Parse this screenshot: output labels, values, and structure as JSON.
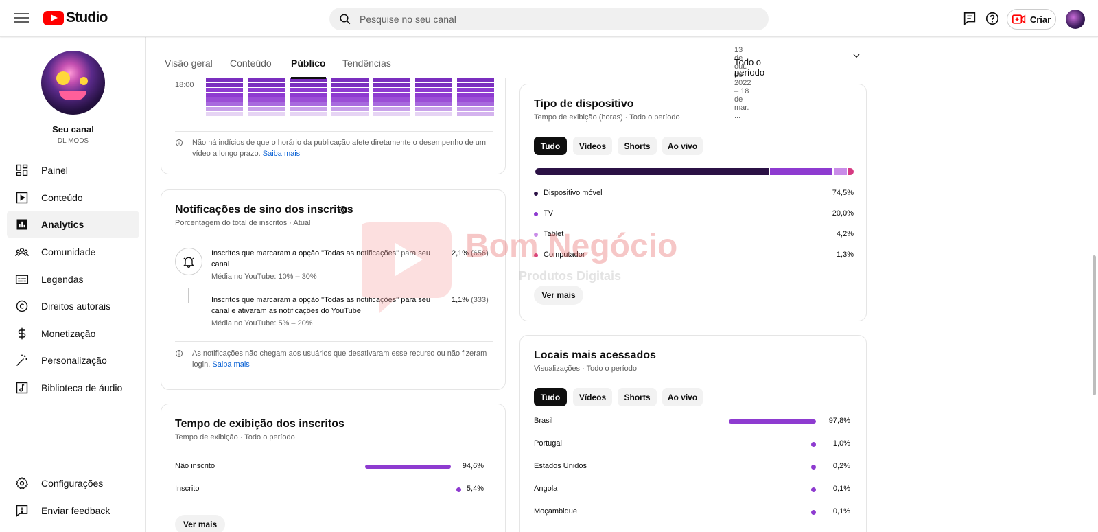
{
  "topbar": {
    "logo_text": "Studio",
    "search_placeholder": "Pesquise no seu canal",
    "create_label": "Criar"
  },
  "sidebar": {
    "channel_name": "Seu canal",
    "channel_handle": "DL MODS",
    "items": [
      {
        "label": "Painel",
        "icon": "dashboard-icon"
      },
      {
        "label": "Conteúdo",
        "icon": "content-icon"
      },
      {
        "label": "Analytics",
        "icon": "analytics-icon",
        "active": true
      },
      {
        "label": "Comunidade",
        "icon": "community-icon"
      },
      {
        "label": "Legendas",
        "icon": "subtitles-icon"
      },
      {
        "label": "Direitos autorais",
        "icon": "copyright-icon"
      },
      {
        "label": "Monetização",
        "icon": "monetization-icon"
      },
      {
        "label": "Personalização",
        "icon": "customization-icon"
      },
      {
        "label": "Biblioteca de áudio",
        "icon": "audio-library-icon"
      }
    ],
    "bottom_items": [
      {
        "label": "Configurações",
        "icon": "settings-icon"
      },
      {
        "label": "Enviar feedback",
        "icon": "feedback-icon"
      }
    ]
  },
  "tabs": [
    "Visão geral",
    "Conteúdo",
    "Público",
    "Tendências"
  ],
  "active_tab": "Público",
  "date": {
    "range": "13 de out. de 2022 – 18 de mar. ...",
    "period": "Todo o período"
  },
  "heatmap_card": {
    "time_label": "18:00",
    "note": "Não há indícios de que o horário da publicação afete diretamente o desempenho de um vídeo a longo prazo.",
    "link": "Saiba mais"
  },
  "bell_card": {
    "title": "Notificações de sino dos inscritos",
    "subtitle": "Porcentagem do total de inscritos · Atual",
    "rows": [
      {
        "text": "Inscritos que marcaram a opção \"Todas as notificações\" para seu canal",
        "avg": "Média no YouTube: 10% – 30%",
        "pct": "2,1%",
        "count": "(656)"
      },
      {
        "text": "Inscritos que marcaram a opção \"Todas as notificações\" para seu canal e ativaram as notificações do YouTube",
        "avg": "Média no YouTube: 5% – 20%",
        "pct": "1,1%",
        "count": "(333)"
      }
    ],
    "note": "As notificações não chegam aos usuários que desativaram esse recurso ou não fizeram login.",
    "link": "Saiba mais"
  },
  "watch_card": {
    "title": "Tempo de exibição dos inscritos",
    "subtitle": "Tempo de exibição · Todo o período",
    "rows": [
      {
        "label": "Não inscrito",
        "pct": "94,6%",
        "value": 94.6
      },
      {
        "label": "Inscrito",
        "pct": "5,4%",
        "value": 5.4
      }
    ],
    "more": "Ver mais"
  },
  "device_card": {
    "title": "Tipo de dispositivo",
    "subtitle": "Tempo de exibição (horas) · Todo o período",
    "filters": [
      "Tudo",
      "Vídeos",
      "Shorts",
      "Ao vivo"
    ],
    "rows": [
      {
        "label": "Dispositivo móvel",
        "pct": "74,5%",
        "value": 74.5,
        "color": "#2b1145"
      },
      {
        "label": "TV",
        "pct": "20,0%",
        "value": 20.0,
        "color": "#8e3bd0"
      },
      {
        "label": "Tablet",
        "pct": "4,2%",
        "value": 4.2,
        "color": "#c98ce8"
      },
      {
        "label": "Computador",
        "pct": "1,3%",
        "value": 1.3,
        "color": "#d63a82"
      }
    ],
    "more": "Ver mais"
  },
  "places_card": {
    "title": "Locais mais acessados",
    "subtitle": "Visualizações · Todo o período",
    "filters": [
      "Tudo",
      "Vídeos",
      "Shorts",
      "Ao vivo"
    ],
    "rows": [
      {
        "label": "Brasil",
        "pct": "97,8%",
        "value": 97.8
      },
      {
        "label": "Portugal",
        "pct": "1,0%",
        "value": 1.0
      },
      {
        "label": "Estados Unidos",
        "pct": "0,2%",
        "value": 0.2
      },
      {
        "label": "Angola",
        "pct": "0,1%",
        "value": 0.1
      },
      {
        "label": "Moçambique",
        "pct": "0,1%",
        "value": 0.1
      }
    ]
  },
  "watermark": {
    "line1": "Bom Negócio",
    "line2": "Produtos Digitais"
  },
  "colors": {
    "accent": "#8e3bd0",
    "dark": "#2b1145",
    "link": "#065fd4"
  }
}
